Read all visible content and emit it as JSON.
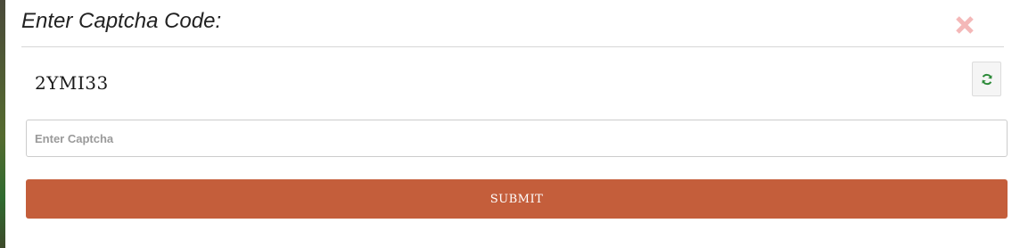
{
  "modal": {
    "title": "Enter Captcha Code:",
    "close_icon": "close-icon",
    "close_color": "#f4b8b8"
  },
  "captcha": {
    "code": "2YMI33",
    "refresh_icon": "refresh-icon",
    "refresh_color": "#2e8b3a"
  },
  "input": {
    "placeholder": "Enter Captcha",
    "value": ""
  },
  "submit": {
    "label": "SUBMIT",
    "color": "#c45e3b"
  }
}
